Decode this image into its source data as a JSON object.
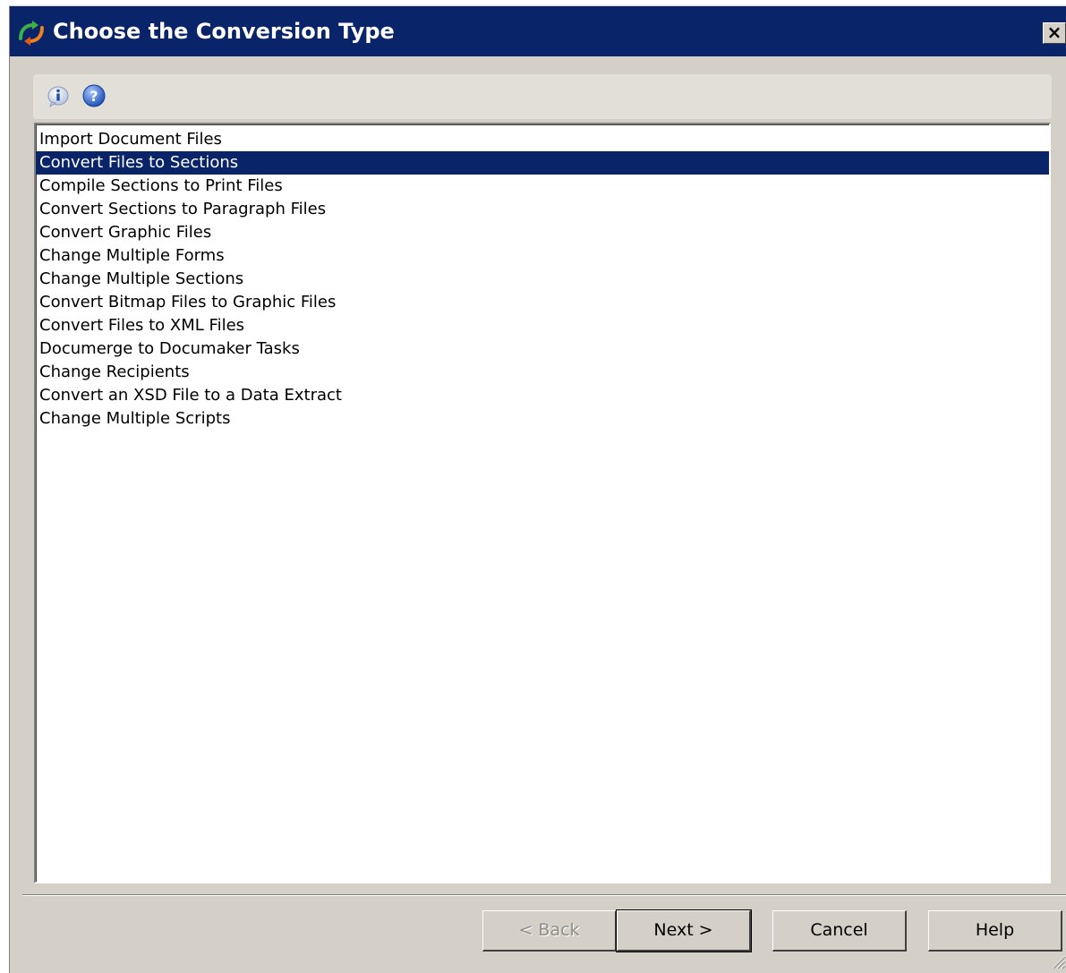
{
  "window": {
    "title": "Choose the Conversion Type",
    "close_label": "×",
    "titlebar_color": "#0a246a",
    "face_color": "#d4d0c8"
  },
  "toolbar": {
    "icons": [
      "info-icon",
      "help-icon"
    ]
  },
  "conversion_types": {
    "selected_index": 1,
    "items": [
      "Import Document Files",
      "Convert Files to Sections",
      "Compile Sections to Print Files",
      "Convert Sections to Paragraph Files",
      "Convert Graphic Files",
      "Change Multiple Forms",
      "Change Multiple Sections",
      "Convert Bitmap Files to Graphic Files",
      "Convert Files to XML Files",
      "Documerge to Documaker Tasks",
      "Change Recipients",
      "Convert an XSD File to a Data Extract",
      "Change Multiple Scripts"
    ]
  },
  "buttons": {
    "back": "< Back",
    "next": "Next >",
    "cancel": "Cancel",
    "help": "Help"
  }
}
